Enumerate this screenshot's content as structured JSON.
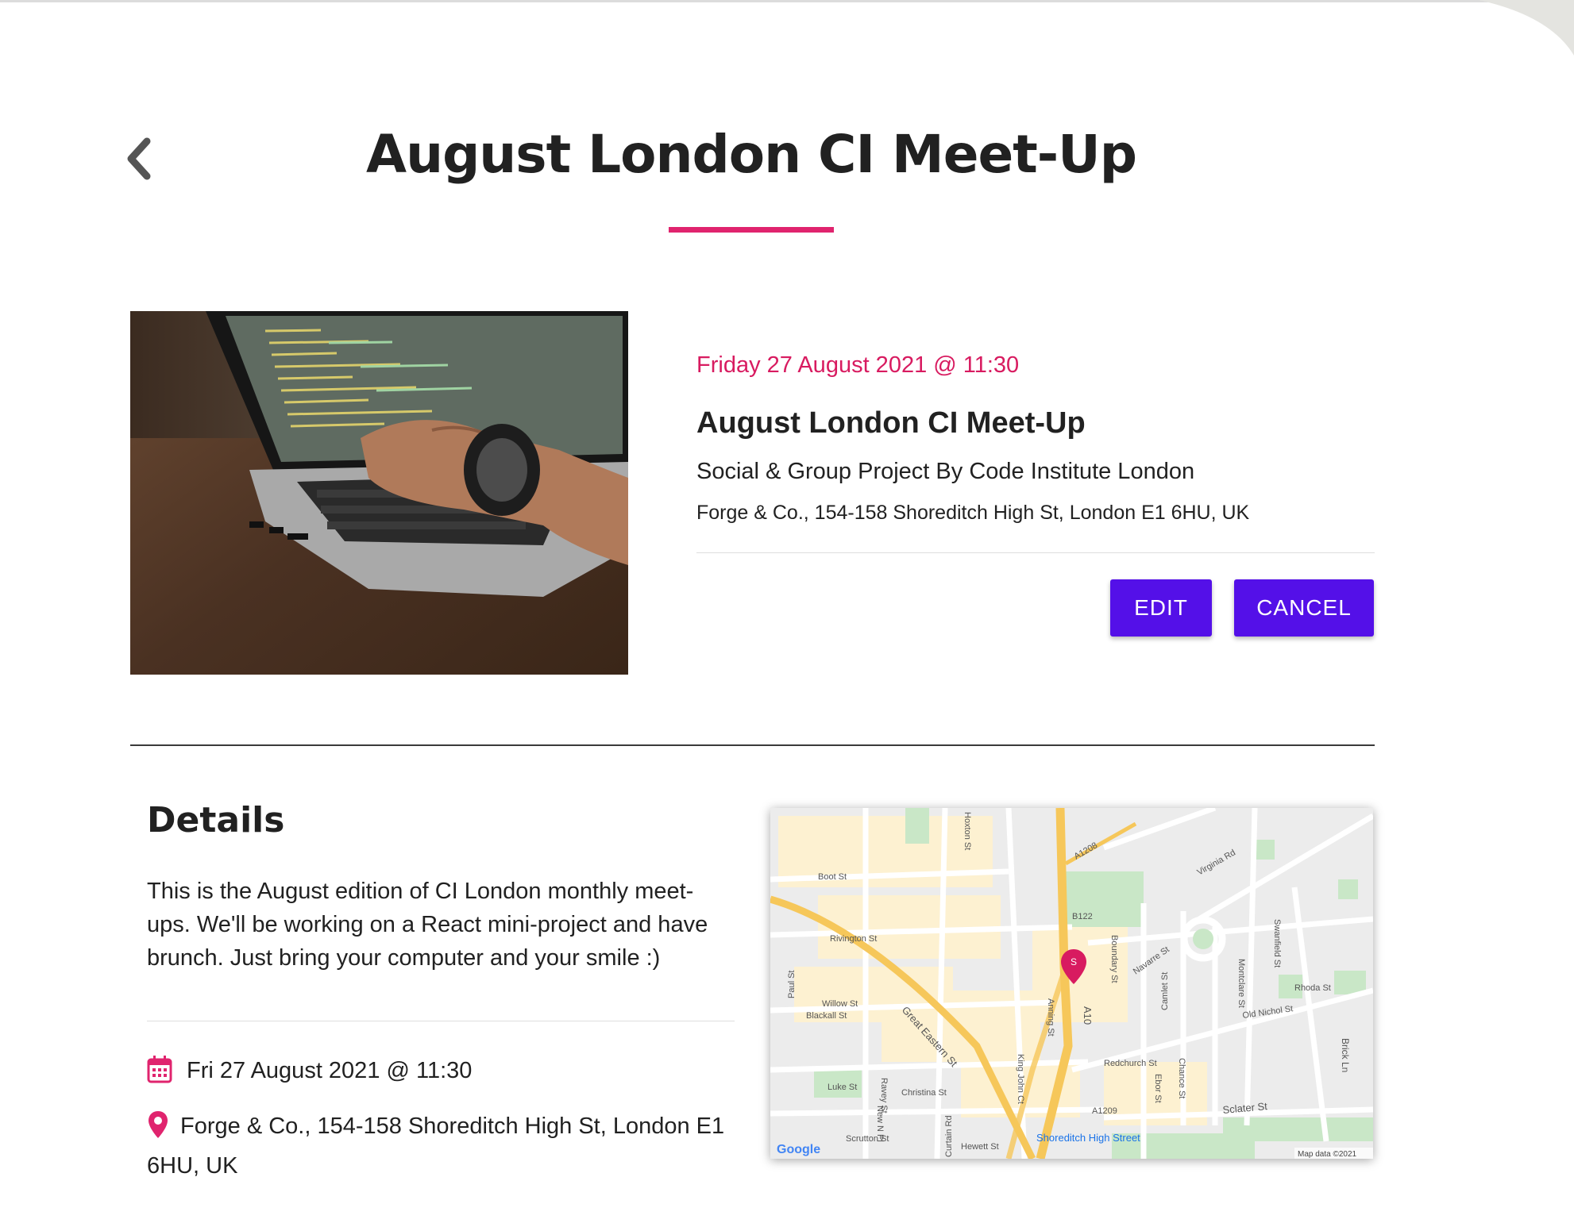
{
  "page": {
    "title": "August London CI Meet-Up"
  },
  "event": {
    "date_time": "Friday 27 August 2021 @ 11:30",
    "name": "August London CI Meet-Up",
    "group": "Social & Group Project By Code Institute London",
    "address": "Forge & Co., 154-158 Shoreditch High St, London E1 6HU, UK"
  },
  "actions": {
    "edit_label": "EDIT",
    "cancel_label": "CANCEL"
  },
  "details": {
    "heading": "Details",
    "description": "This is the August edition of CI London monthly meet-ups. We'll be working on a React mini-project and have brunch. Just bring your computer and your smile :)",
    "date_short": "Fri 27 August 2021 @ 11:30",
    "location": "Forge & Co., 154-158 Shoreditch High St, London E1 6HU, UK"
  },
  "map": {
    "streets": [
      "Boot St",
      "Rivington St",
      "Paul St",
      "Willow St",
      "Blackall St",
      "Great Eastern St",
      "Luke St",
      "Christina St",
      "Scrutton St",
      "Curtain Rd",
      "Hewett St",
      "Ravey St",
      "New N Pl",
      "King John Ct",
      "Anning St",
      "A10",
      "A1208",
      "B122",
      "Boundary St",
      "Navarre St",
      "Virginia Rd",
      "Swanfield St",
      "Montclare St",
      "Camlet St",
      "Chance St",
      "Ebor St",
      "Redchurch St",
      "Rhoda St",
      "Old Nichol St",
      "Brick Ln",
      "Sclater St",
      "A1209",
      "Hoxton St"
    ],
    "station": "Shoreditch High Street",
    "pin_label": "S",
    "google_logo": "Google",
    "attribution": "Map data ©2021"
  },
  "colors": {
    "accent": "#e0246e",
    "date_text": "#d81b60",
    "button": "#5410e8",
    "road_major": "#f6c75a",
    "map_bg": "#ececec"
  },
  "icons": {
    "back": "chevron-left-icon",
    "calendar": "calendar-icon",
    "location": "map-pin-icon"
  }
}
